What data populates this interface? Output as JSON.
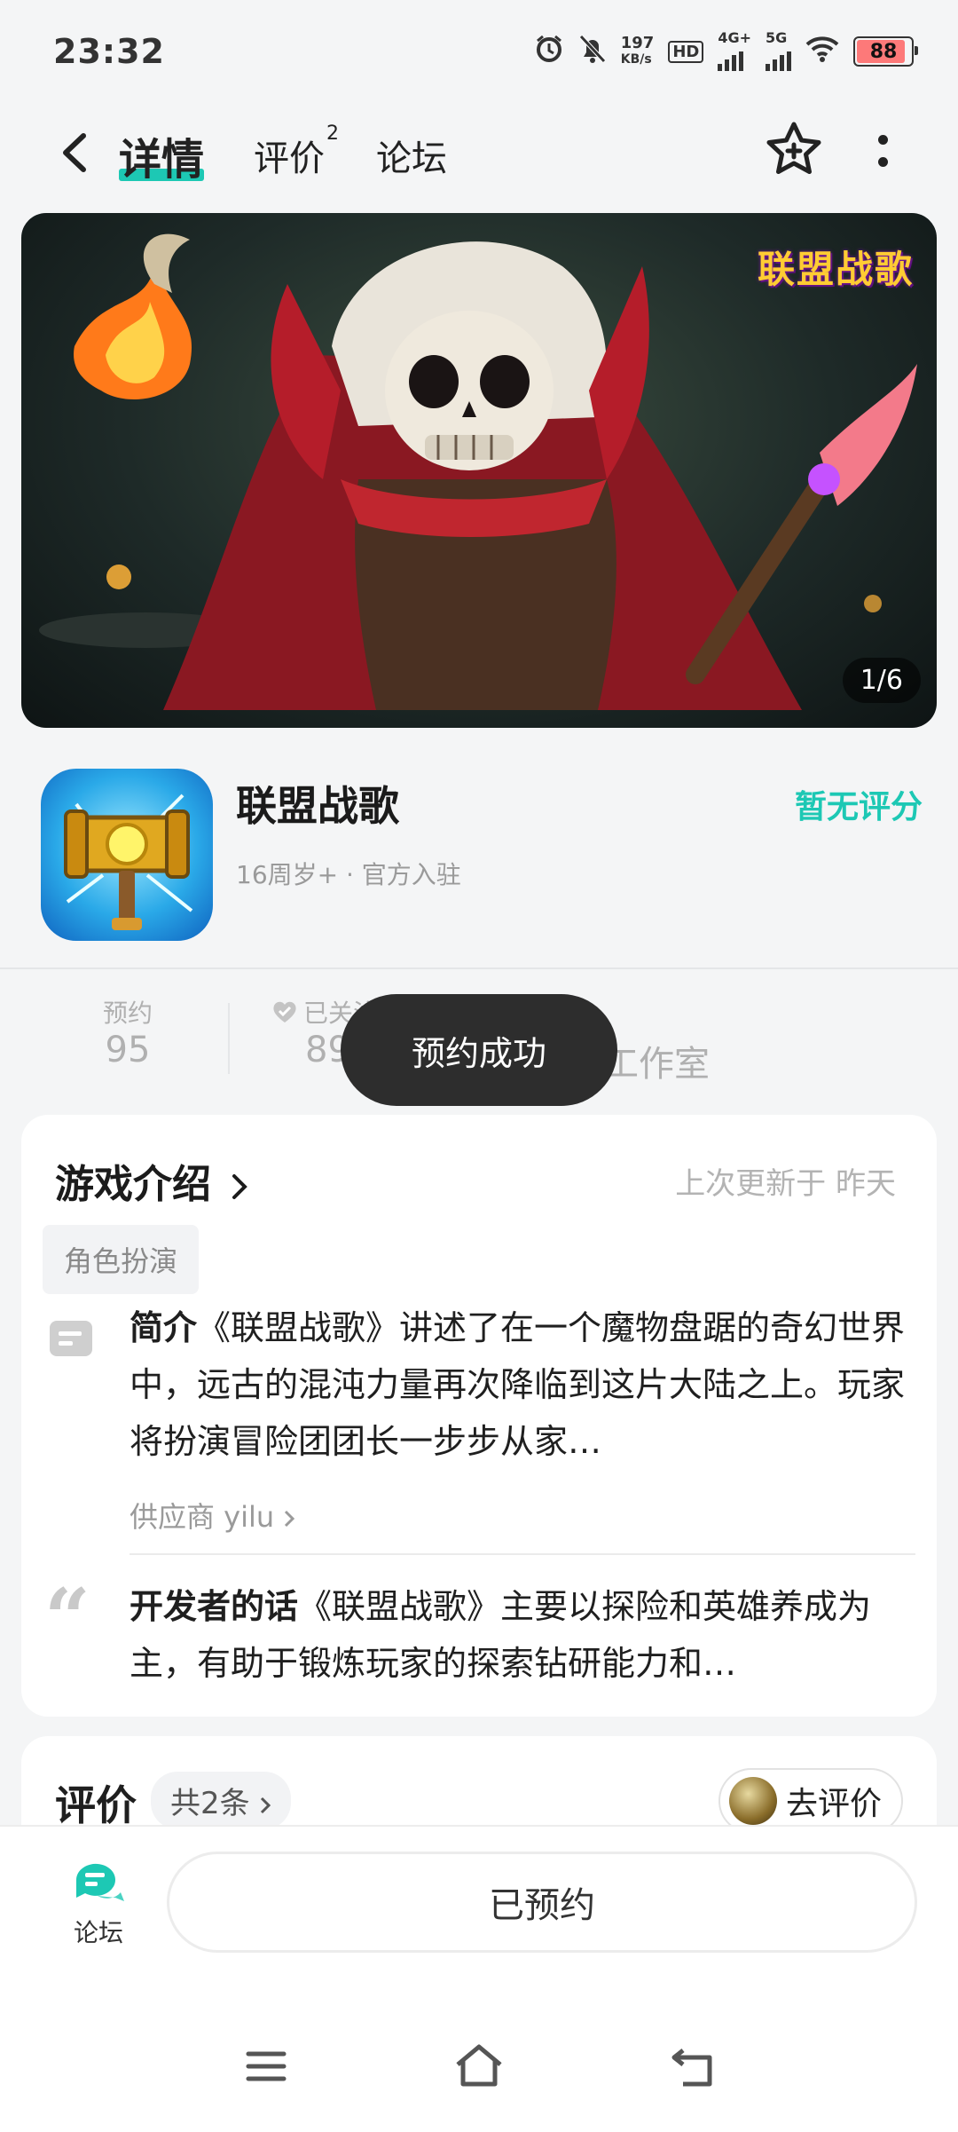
{
  "status_bar": {
    "time": "23:32",
    "net_speed_value": "197",
    "net_speed_unit": "KB/s",
    "hd_label": "HD",
    "sim1_type": "4G+",
    "sim2_type": "5G",
    "battery": "88"
  },
  "top_nav": {
    "tabs": [
      {
        "label": "详情",
        "active": true
      },
      {
        "label": "评价",
        "badge": "2"
      },
      {
        "label": "论坛"
      }
    ],
    "accent_color": "#1dc8b4"
  },
  "banner": {
    "logo_text": "联盟战歌",
    "counter": "1/6"
  },
  "app": {
    "name": "联盟战歌",
    "meta": "16周岁+ · 官方入驻",
    "rating_text": "暂无评分"
  },
  "stats": [
    {
      "label": "预约",
      "value": "95"
    },
    {
      "label": "已关注",
      "value": "89"
    },
    {
      "label": "",
      "value": "工作室"
    }
  ],
  "toast": "预约成功",
  "intro": {
    "title": "游戏介绍",
    "updated": "上次更新于 昨天",
    "tag": "角色扮演",
    "summary_label": "简介",
    "summary_text": "《联盟战歌》讲述了在一个魔物盘踞的奇幻世界中，远古的混沌力量再次降临到这片大陆之上。玩家将扮演冒险团团长一步步从家…",
    "supplier": "供应商 yilu",
    "dev_label": "开发者的话",
    "dev_text": "《联盟战歌》主要以探险和英雄养成为主，有助于锻炼玩家的探索钻研能力和…"
  },
  "reviews": {
    "title": "评价",
    "count": "共2条",
    "go_review": "去评价"
  },
  "bottom_bar": {
    "forum_label": "论坛",
    "reserved_label": "已预约"
  }
}
